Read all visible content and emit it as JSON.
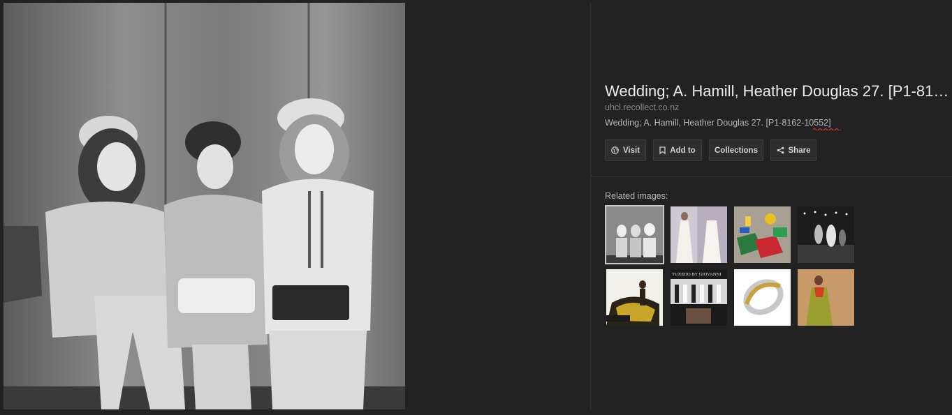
{
  "result": {
    "title": "Wedding; A. Hamill, Heather Douglas 27. [P1-8162-10552]",
    "domain": "uhcl.recollect.co.nz",
    "description": "Wedding; A. Hamill, Heather Douglas 27. [P1-8162-10552]"
  },
  "actions": {
    "visit": "Visit",
    "add_to": "Add to",
    "collections": "Collections",
    "share": "Share"
  },
  "related": {
    "label": "Related images:",
    "thumbs": [
      "",
      "",
      "",
      "",
      "",
      "",
      "",
      ""
    ],
    "thumb_tux_text": "TUXEDO BY GIOVANNI"
  },
  "colors": {
    "background": "#222222",
    "spellcheck_underline": "#d93025"
  },
  "icons": [
    "globe-icon",
    "bookmark-icon",
    "share-icon"
  ]
}
